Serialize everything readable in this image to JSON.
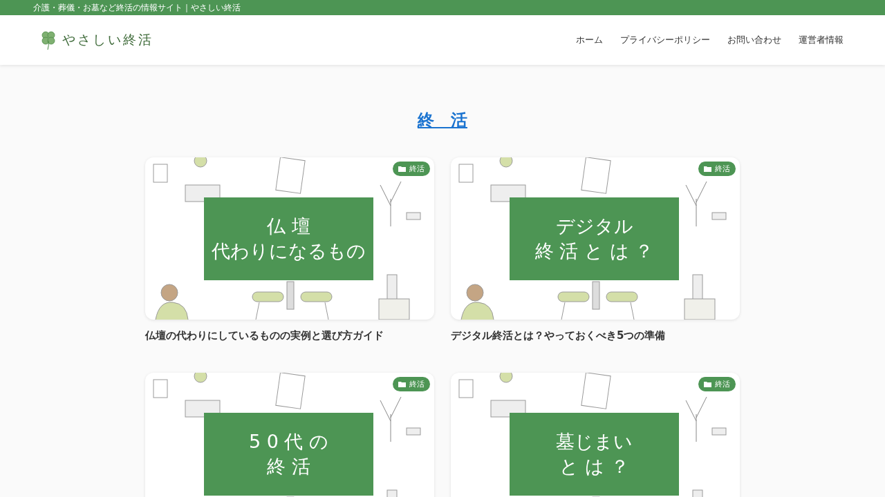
{
  "top_bar": {
    "tagline": "介護・葬儀・お墓など終活の情報サイト｜やさしい終活"
  },
  "header": {
    "logo": "やさしい終活",
    "nav": [
      "ホーム",
      "プライバシーポリシー",
      "お問い合わせ",
      "運営者情報"
    ]
  },
  "category_title": "終　活",
  "posts": [
    {
      "category": "終活",
      "thumbnail_lines": [
        "仏 壇",
        "代わりになるもの"
      ],
      "title": "仏壇の代わりにしているものの実例と選び方ガイド"
    },
    {
      "category": "終活",
      "thumbnail_lines": [
        "デジタル",
        "終 活 と は ？"
      ],
      "title": "デジタル終活とは？やっておくべき5つの準備"
    },
    {
      "category": "終活",
      "thumbnail_lines": [
        "5 0 代 の",
        "終 活"
      ]
    },
    {
      "category": "終活",
      "thumbnail_lines": [
        "墓じまい",
        "と は ？"
      ]
    }
  ]
}
